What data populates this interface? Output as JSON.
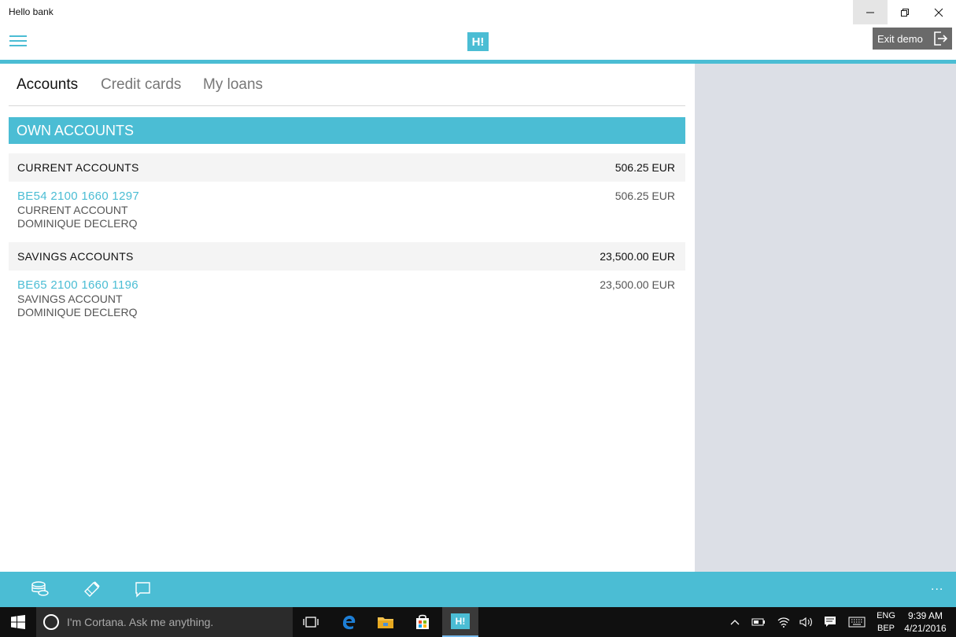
{
  "window": {
    "title": "Hello bank"
  },
  "header": {
    "logo_text": "H!",
    "exit_demo_label": "Exit demo"
  },
  "tabs": [
    {
      "label": "Accounts",
      "active": true
    },
    {
      "label": "Credit cards",
      "active": false
    },
    {
      "label": "My loans",
      "active": false
    }
  ],
  "section": {
    "title": "OWN ACCOUNTS"
  },
  "groups": [
    {
      "name": "CURRENT ACCOUNTS",
      "total": "506.25 EUR",
      "accounts": [
        {
          "iban": "BE54 2100 1660 1297",
          "type": "CURRENT ACCOUNT",
          "owner": "DOMINIQUE DECLERQ",
          "balance": "506.25 EUR"
        }
      ]
    },
    {
      "name": "SAVINGS ACCOUNTS",
      "total": "23,500.00 EUR",
      "accounts": [
        {
          "iban": "BE65 2100 1660 1196",
          "type": "SAVINGS ACCOUNT",
          "owner": "DOMINIQUE DECLERQ",
          "balance": "23,500.00 EUR"
        }
      ]
    }
  ],
  "appbar": {
    "icons": [
      "coins-icon",
      "payment-pen-icon",
      "message-icon"
    ],
    "more_label": "..."
  },
  "taskbar": {
    "cortana_placeholder": "I'm Cortana. Ask me anything.",
    "active_app_label": "H!",
    "language": "ENG",
    "keyboard": "BEP",
    "time": "9:39 AM",
    "date": "4/21/2016"
  },
  "colors": {
    "accent": "#4bbdd4",
    "side_pane": "#dcdfe6",
    "taskbar": "#101010"
  }
}
